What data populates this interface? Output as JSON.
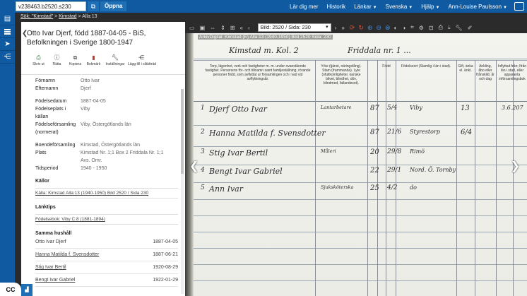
{
  "topbar": {
    "id_value": "v238463.b2520.s230",
    "open_label": "Öppna",
    "nav": [
      {
        "label": "Lär dig mer",
        "caret": false
      },
      {
        "label": "Historik",
        "caret": false
      },
      {
        "label": "Länkar",
        "caret": true
      },
      {
        "label": "Svenska",
        "caret": true
      },
      {
        "label": "Hjälp",
        "caret": true
      },
      {
        "label": "Ann-Louise Paulsson",
        "caret": true
      }
    ]
  },
  "breadcrumb": {
    "items": [
      "Sök: \"Kimstad\"",
      "Kimstad",
      "Alla:13"
    ],
    "separator": " > "
  },
  "panel": {
    "title": "Otto Ivar Djerf, född 1887-04-05 - BiS, Befolkningen i Sverige 1800-1947",
    "actions": [
      "Skriv ut",
      "Rätta",
      "Kopiera",
      "Bokmärk",
      "Inställningar",
      "Lägg till i släktträd"
    ],
    "fields": [
      {
        "k": "Förnamn",
        "v": "Otto Ivar"
      },
      {
        "k": "Efternamn",
        "v": "Djerf"
      },
      {
        "gap": true
      },
      {
        "k": "Födelsedatum",
        "v": "1887-04-05"
      },
      {
        "k": "Födelseplats i",
        "v": "Viby"
      },
      {
        "k": "källan",
        "v": ""
      },
      {
        "k": "Födelseförsamling",
        "v": "Viby, Östergötlands län"
      },
      {
        "k": "(normerat)",
        "v": ""
      },
      {
        "gap": true
      },
      {
        "k": "Boendeförsamling",
        "v": "Kimstad, Östergötlands län"
      },
      {
        "k": "Plats",
        "v": "Kimstad Nr. 1;1 Box 2 Friddala Nr. 1;1"
      },
      {
        "k": "",
        "v": "Avs. Omr."
      },
      {
        "k": "Tidsperiod",
        "v": "1940 - 1950"
      }
    ],
    "sources_heading": "Källor",
    "source_link": "Källa: Kimstad Alla:13 (1940-1950) Bild 2520 / Sida 230",
    "links_heading": "Länktips",
    "link_tip": "Födelsebok: Viby C:8 (1881-1894)",
    "household_heading": "Samma hushåll",
    "household": [
      {
        "name": "Otto Ivar Djerf",
        "date": "1887-04-05",
        "link": false
      },
      {
        "name": "Hanna Matilda f. Svensdotter",
        "date": "1887-06-21",
        "link": true
      },
      {
        "name": "Stig Ivar Bertil",
        "date": "1920-08-29",
        "link": true
      },
      {
        "name": "Bengt Ivar Gabriel",
        "date": "1922-01-29",
        "link": true
      }
    ]
  },
  "viewer": {
    "page_select": "Bild: 2520 / Sida: 230",
    "caption": "ArkivDigital: Kimstad (E) Alla:13 (1940-1950) Bild 2520 Sida: 230"
  },
  "document": {
    "heading_left": "Kimstad m. Kol. 2",
    "heading_right": "Friddala nr. 1 ...",
    "col_header_1": "Torp, lägenhet, verk och fastigheter m. m. under ovanstående fastighet. Personens för- och tillnamn samt familjeställning, rörande personer född, som avflyttat ur församlingen och i vad vid avflyttningsår.",
    "col_header_2": "Yrke (tjänst, näringsfång). Stam (frammanda). Lyte (ofullkomligheter, kanske blivet, blindhet, döv, blindmed, fallandesot).",
    "col_header_3": "Född",
    "col_header_4": "Födelseort (Stamlig i län i stad).",
    "col_header_5": "Gift, änka el. änkl.",
    "col_header_6": "Ankling, åbo eller frånskild, år och dag",
    "col_header_7": "Inflyttad från; Ifrån län i stad, eller apparanta införsamlingsbok",
    "entries": [
      {
        "no": "1",
        "name": "Djerf Otto Ivar",
        "job": "Lantarbetare",
        "yr": "87",
        "md": "5/4",
        "place": "Viby",
        "gift": "13",
        "extra": "3.6.207"
      },
      {
        "no": "2",
        "name": "Hanna Matilda f. Svensdotter",
        "job": "",
        "yr": "87",
        "md": "21/6",
        "place": "Styrestorp",
        "gift": "6/4",
        "extra": ""
      },
      {
        "no": "3",
        "name": "Stig Ivar Bertil",
        "job": "Måleri",
        "yr": "20",
        "md": "29/8",
        "place": "Rimö",
        "gift": "",
        "extra": ""
      },
      {
        "no": "4",
        "name": "Bengt Ivar Gabriel",
        "job": "",
        "yr": "22",
        "md": "29/1",
        "place": "Nord. Ö. Tornby",
        "gift": "",
        "extra": ""
      },
      {
        "no": "5",
        "name": "Ann Ivar",
        "job": "Sjuksköterska",
        "yr": "25",
        "md": "4/2",
        "place": "do",
        "gift": "",
        "extra": ""
      }
    ]
  }
}
